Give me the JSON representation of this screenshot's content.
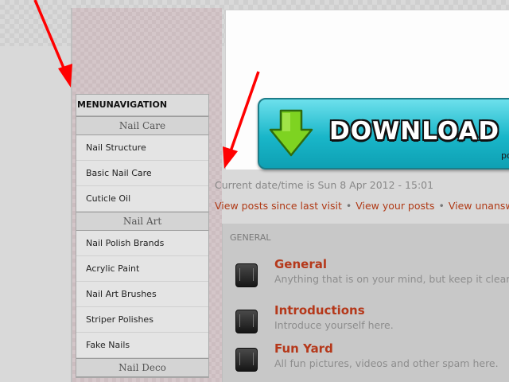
{
  "menu": {
    "title": "MENUNAVIGATION",
    "categories": [
      {
        "label": "Nail Care",
        "items": [
          "Nail Structure",
          "Basic Nail Care",
          "Cuticle Oil"
        ]
      },
      {
        "label": "Nail Art",
        "items": [
          "Nail Polish Brands",
          "Acrylic Paint",
          "Nail Art Brushes",
          "Striper Polishes",
          "Fake Nails"
        ]
      },
      {
        "label": "Nail Deco",
        "items": []
      }
    ]
  },
  "banner": {
    "label": "DOWNLOAD N",
    "sub": "po",
    "icon": "download-arrow-icon",
    "colors": {
      "button": "#19b6c9",
      "arrow": "#7ed321"
    }
  },
  "info": {
    "datetime": "Current date/time is Sun 8 Apr 2012 - 15:01",
    "links": [
      "View posts since last visit",
      "View your posts",
      "View unansw"
    ],
    "separator": "•"
  },
  "forum": {
    "section": "GENERAL",
    "forums": [
      {
        "name": "General",
        "desc": "Anything that is on your mind, but keep it clear"
      },
      {
        "name": "Introductions",
        "desc": "Introduce yourself here."
      },
      {
        "name": "Fun Yard",
        "desc": "All fun pictures, videos and other spam here."
      }
    ]
  },
  "colors": {
    "link": "#b03a16",
    "forum_title": "#b5381a",
    "annotation_arrow": "#ff0000"
  }
}
